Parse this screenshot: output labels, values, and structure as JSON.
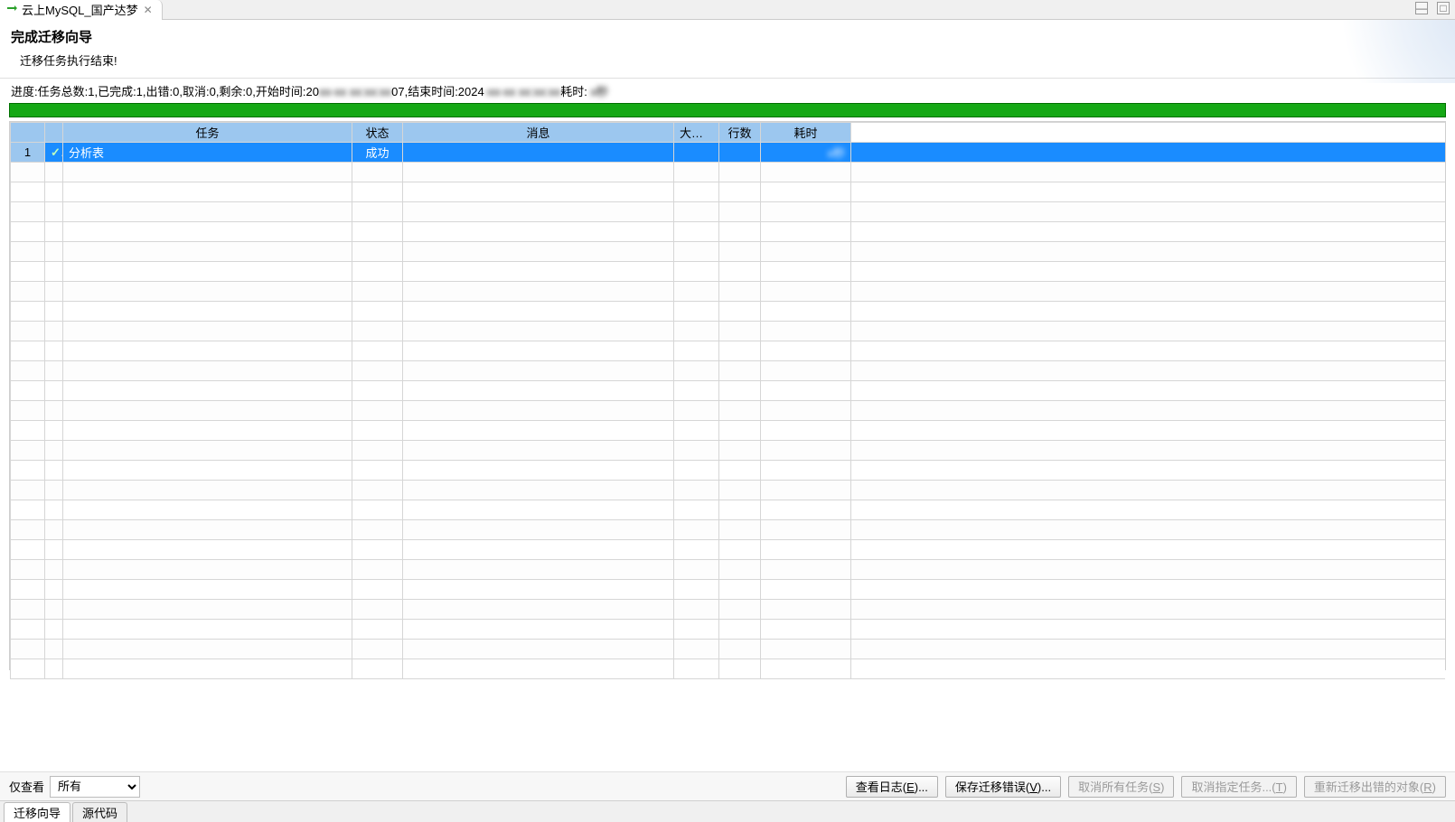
{
  "tab": {
    "title": "云上MySQL_国产达梦"
  },
  "header": {
    "title": "完成迁移向导",
    "subtitle": "迁移任务执行结束!"
  },
  "progress": {
    "text": "进度:任务总数:1,已完成:1,出错:0,取消:0,剩余:0,开始时间:20",
    "text_mid": "07,结束时间:2024",
    "text_end": "耗时:",
    "hidden1": "xx-xx xx:xx:xx",
    "hidden2": "-xx-xx xx:xx:xx",
    "hidden3": "x秒",
    "percent": 100
  },
  "table": {
    "headers": {
      "task": "任务",
      "status": "状态",
      "msg": "消息",
      "bigfield": "大字段",
      "rows": "行数",
      "time": "耗时"
    },
    "rows": [
      {
        "n": "1",
        "mark": "✓",
        "task": "分析表",
        "status": "成功",
        "msg": "",
        "bigfield": "",
        "rowcount": "",
        "time": "",
        "time_hidden": "x秒"
      }
    ]
  },
  "footer": {
    "only_view": "仅查看",
    "filter_selected": "所有",
    "buttons": {
      "view_log": "查看日志(",
      "view_log_mn": "E",
      "view_log_end": ")...",
      "save_err": "保存迁移错误(",
      "save_err_mn": "V",
      "save_err_end": ")...",
      "cancel_all": "取消所有任务(",
      "cancel_all_mn": "S",
      "cancel_all_end": ")",
      "cancel_sel": "取消指定任务...(",
      "cancel_sel_mn": "T",
      "cancel_sel_end": ")",
      "retry": "重新迁移出错的对象(",
      "retry_mn": "R",
      "retry_end": ")"
    }
  },
  "bottom_tabs": {
    "wizard": "迁移向导",
    "source": "源代码"
  }
}
